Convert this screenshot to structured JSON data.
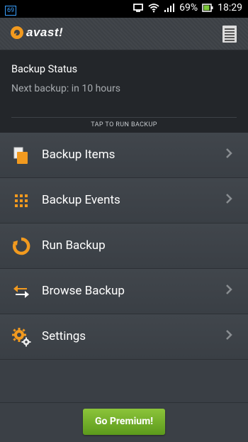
{
  "statusbar": {
    "notification_badge": "69",
    "battery_percent": "69%",
    "time": "18:29"
  },
  "app": {
    "logo_text": "avast!"
  },
  "status_panel": {
    "title": "Backup Status",
    "next_backup": "Next backup: in 10 hours",
    "tap_action": "TAP TO RUN BACKUP"
  },
  "menu": {
    "items": [
      {
        "label": "Backup Items",
        "icon": "backup-items-icon"
      },
      {
        "label": "Backup Events",
        "icon": "backup-events-icon"
      },
      {
        "label": "Run Backup",
        "icon": "run-backup-icon"
      },
      {
        "label": "Browse Backup",
        "icon": "browse-backup-icon"
      },
      {
        "label": "Settings",
        "icon": "settings-gear-icon"
      }
    ]
  },
  "footer": {
    "premium_label": "Go Premium!"
  },
  "colors": {
    "accent_orange": "#f29a1f",
    "premium_green": "#6aa824"
  }
}
